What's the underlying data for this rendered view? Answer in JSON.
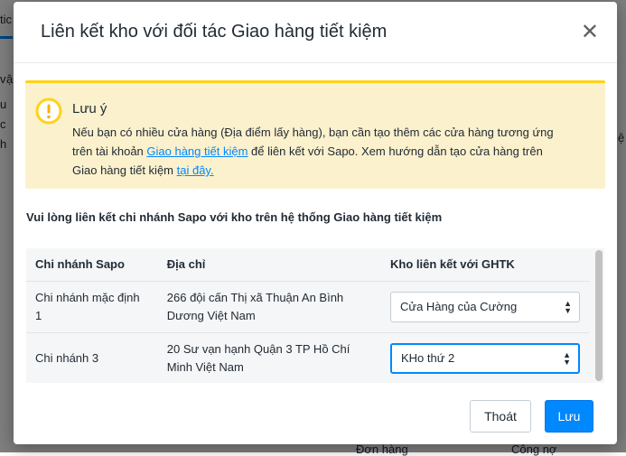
{
  "background": {
    "fragments": [
      "tic",
      "v",
      "ậ",
      "u",
      "c",
      "h",
      "ệ",
      "Đơn hàng",
      "Công nợ"
    ]
  },
  "modal": {
    "title": "Liên kết kho với đối tác Giao hàng tiết kiệm",
    "close_icon": "close-icon",
    "alert": {
      "icon": "exclamation-circle-icon",
      "title": "Lưu ý",
      "line1": "Nếu bạn có nhiều cửa hàng (Địa điểm lấy hàng), bạn cần tạo thêm các cửa hàng tương ứng",
      "line2_prefix": "trên tài khoản ",
      "line2_link": "Giao hàng tiết kiệm",
      "line2_suffix": " để liên kết với Sapo. Xem hướng dẫn tạo cửa hàng trên",
      "line3_prefix": "Giao hàng tiết kiệm ",
      "line3_link": "tại đây."
    },
    "instruction": "Vui lòng liên kết chi nhánh Sapo với kho trên hệ thống Giao hàng tiết kiệm",
    "table": {
      "headers": [
        "Chi nhánh Sapo",
        "Địa chỉ",
        "Kho liên kết với GHTK"
      ],
      "rows": [
        {
          "branch": "Chi nhánh mặc định 1",
          "address": "266 đội cấn Thị xã Thuận An Bình Dương Việt Nam",
          "warehouse": "Cửa Hàng của Cường"
        },
        {
          "branch": "Chi nhánh 3",
          "address": "20 Sư vạn hạnh Quận 3 TP Hồ Chí Minh Việt Nam",
          "warehouse": "KHo thứ 2"
        }
      ]
    },
    "buttons": {
      "cancel": "Thoát",
      "save": "Lưu"
    }
  },
  "colors": {
    "accent": "#0088ff",
    "alert_bg": "#fcf1cd",
    "alert_border": "#ffd21a"
  }
}
